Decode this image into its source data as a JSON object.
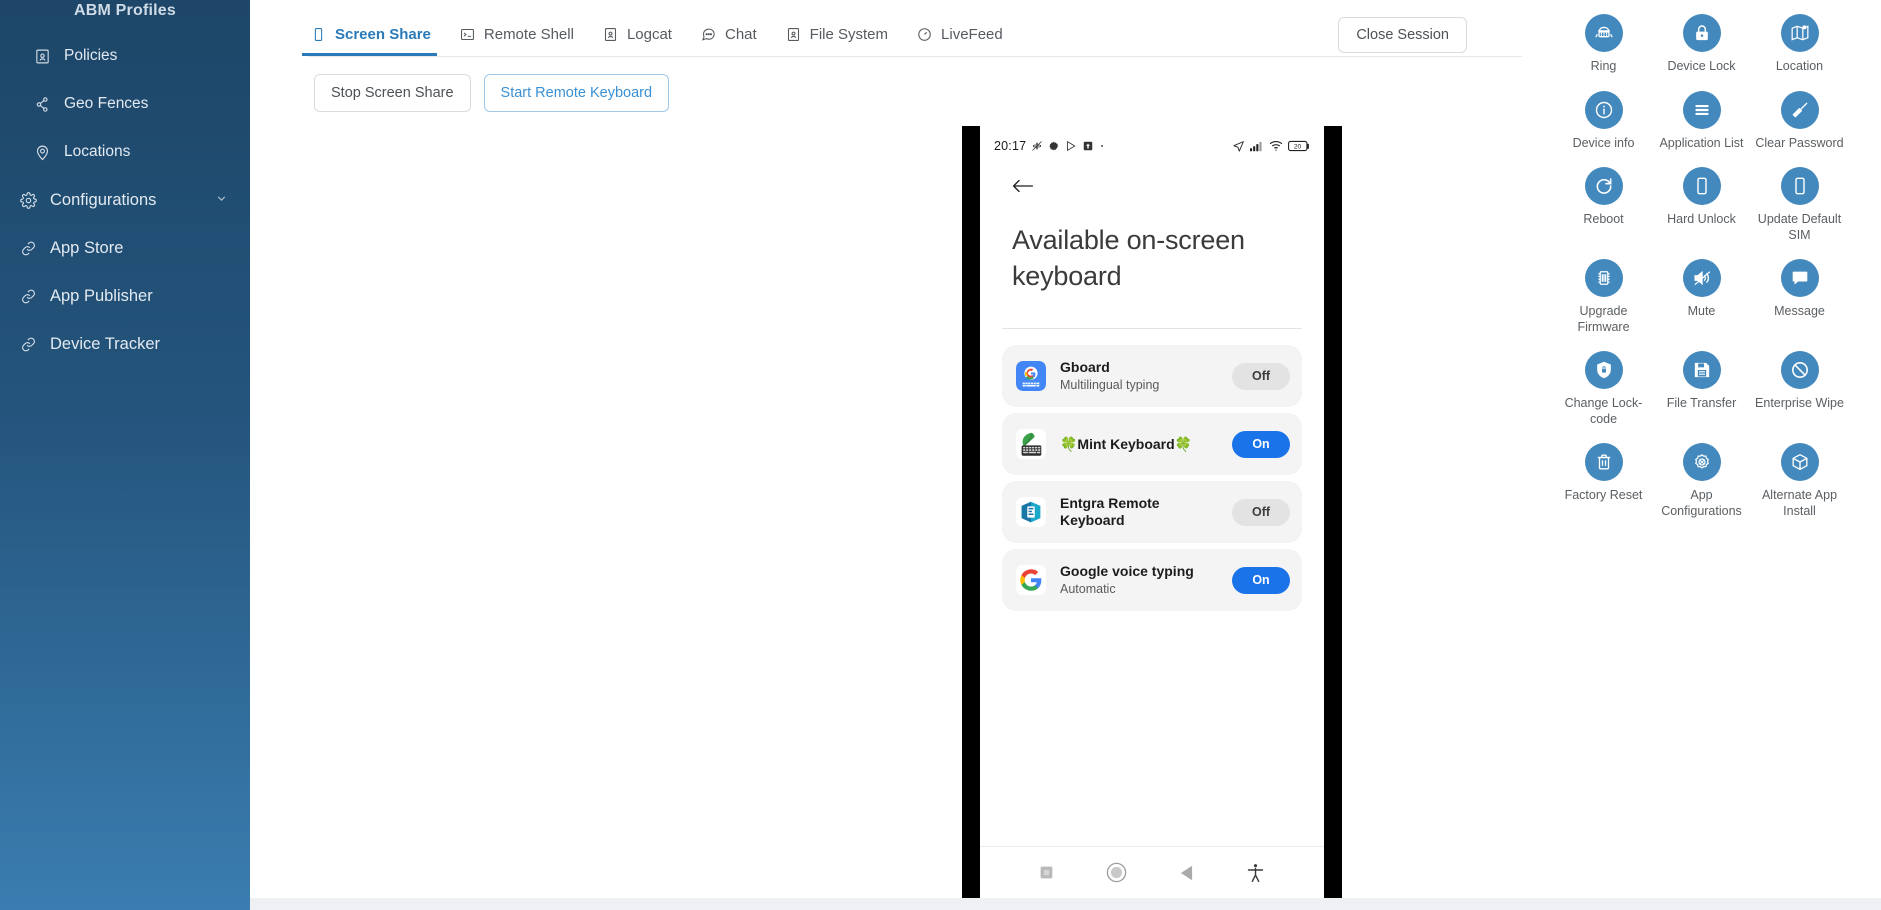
{
  "sidebar": {
    "header": "ABM Profiles",
    "items": [
      {
        "label": "Policies",
        "icon": "policy-icon",
        "sub": true
      },
      {
        "label": "Geo Fences",
        "icon": "geofence-icon",
        "sub": true
      },
      {
        "label": "Locations",
        "icon": "location-pin-icon",
        "sub": true
      },
      {
        "label": "Configurations",
        "icon": "gear-icon",
        "sub": false,
        "chevron": "chevron-down-icon"
      },
      {
        "label": "App Store",
        "icon": "link-icon",
        "sub": false
      },
      {
        "label": "App Publisher",
        "icon": "link-icon",
        "sub": false
      },
      {
        "label": "Device Tracker",
        "icon": "link-icon",
        "sub": false
      }
    ]
  },
  "tabs": [
    {
      "label": "Screen Share",
      "icon": "mobile-icon",
      "active": true
    },
    {
      "label": "Remote Shell",
      "icon": "terminal-icon",
      "active": false
    },
    {
      "label": "Logcat",
      "icon": "logcat-icon",
      "active": false
    },
    {
      "label": "Chat",
      "icon": "chat-icon",
      "active": false
    },
    {
      "label": "File System",
      "icon": "file-system-icon",
      "active": false
    },
    {
      "label": "LiveFeed",
      "icon": "livefeed-icon",
      "active": false
    }
  ],
  "toolbar": {
    "close_session": "Close Session",
    "stop_screen_share": "Stop Screen Share",
    "start_remote_keyboard": "Start Remote Keyboard"
  },
  "phone": {
    "statusbar": {
      "time": "20:17",
      "left_icons": [
        "no-vibrate-icon",
        "gear-icon",
        "play-store-icon",
        "upload-icon"
      ],
      "right_icons": [
        "location-arrow-icon",
        "signal-bars-icon",
        "wifi-icon"
      ],
      "battery_level": "20"
    },
    "back_icon": "arrow-left-icon",
    "title": "Available on-screen keyboard",
    "keyboards": [
      {
        "name": "Gboard",
        "subtitle": "Multilingual typing",
        "state": "Off",
        "icon": "gboard-icon"
      },
      {
        "name": "🍀Mint Keyboard🍀",
        "subtitle": "",
        "state": "On",
        "icon": "mint-keyboard-icon"
      },
      {
        "name": "Entgra Remote Keyboard",
        "subtitle": "",
        "state": "Off",
        "icon": "entgra-icon"
      },
      {
        "name": "Google voice typing",
        "subtitle": "Automatic",
        "state": "On",
        "icon": "google-icon"
      }
    ],
    "navbar": [
      "recents-square-icon",
      "home-circle-icon",
      "back-triangle-icon",
      "accessibility-icon"
    ]
  },
  "actions": [
    {
      "label": "Ring",
      "icon": "ring-phone-icon"
    },
    {
      "label": "Device Lock",
      "icon": "lock-icon"
    },
    {
      "label": "Location",
      "icon": "map-icon"
    },
    {
      "label": "Device info",
      "icon": "info-icon"
    },
    {
      "label": "Application List",
      "icon": "list-icon"
    },
    {
      "label": "Clear Password",
      "icon": "broom-icon"
    },
    {
      "label": "Reboot",
      "icon": "reboot-icon"
    },
    {
      "label": "Hard Unlock",
      "icon": "mobile-icon"
    },
    {
      "label": "Update Default SIM",
      "icon": "mobile-icon"
    },
    {
      "label": "Upgrade Firmware",
      "icon": "chip-icon"
    },
    {
      "label": "Mute",
      "icon": "mute-icon"
    },
    {
      "label": "Message",
      "icon": "message-icon"
    },
    {
      "label": "Change Lock-code",
      "icon": "shield-lock-icon"
    },
    {
      "label": "File Transfer",
      "icon": "floppy-disk-icon"
    },
    {
      "label": "Enterprise Wipe",
      "icon": "ban-icon"
    },
    {
      "label": "Factory Reset",
      "icon": "trash-icon"
    },
    {
      "label": "App Configurations",
      "icon": "gear-x-icon"
    },
    {
      "label": "Alternate App Install",
      "icon": "box-icon"
    }
  ],
  "colors": {
    "accent": "#2a7ab9",
    "action_circle": "#4489bd",
    "toggle_on": "#1a73e8",
    "sidebar_top": "#1d4668",
    "sidebar_bottom": "#3a7db0"
  }
}
